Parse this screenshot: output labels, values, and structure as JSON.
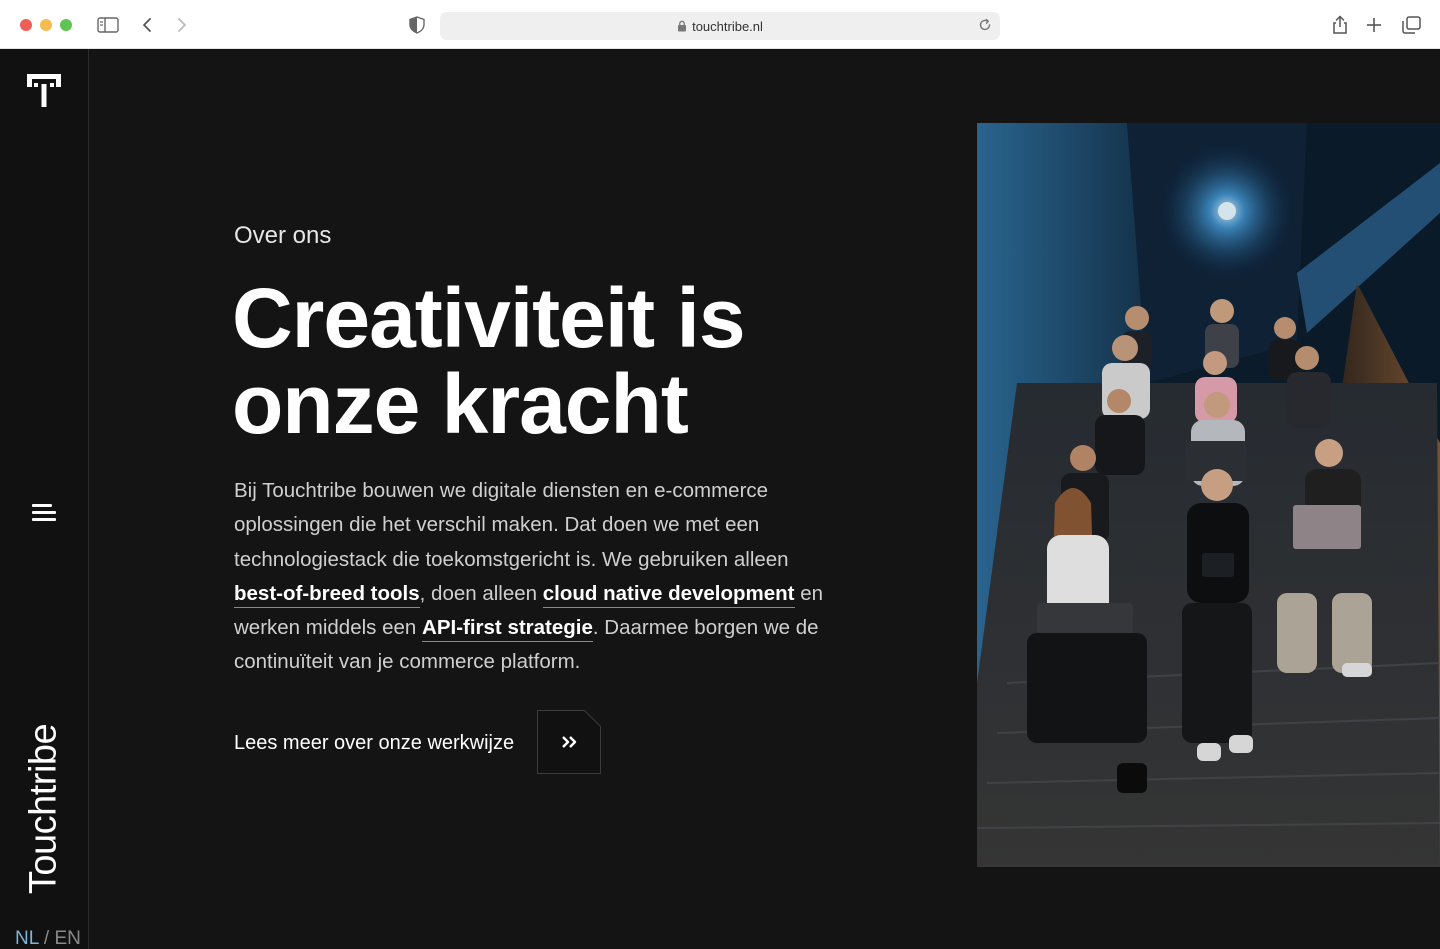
{
  "browser": {
    "url": "touchtribe.nl"
  },
  "sidebar": {
    "brand": "Touchtribe",
    "lang_nl": "NL",
    "lang_sep": " / ",
    "lang_en": "EN"
  },
  "hero": {
    "eyebrow": "Over ons",
    "headline_line1": "Creativiteit is",
    "headline_line2": "onze kracht",
    "body": {
      "part1": "Bij Touchtribe bouwen we digitale diensten en e-commerce oplossingen die het verschil maken. Dat doen we met een technologiestack die toekomstgericht is. We gebruiken alleen ",
      "link1": "best-of-breed tools",
      "part2": ", doen alleen ",
      "link2": "cloud native development",
      "part3": " en werken middels een ",
      "link3": "API-first strategie",
      "part4": ". Daarmee borgen we de continuïteit van je commerce platform."
    },
    "cta_label": "Lees meer over onze werkwijze",
    "cta_icon": "double-chevron-right-icon"
  },
  "photo": {
    "alt_semantic": "team-photo-on-stairs"
  },
  "colors": {
    "page_bg": "#141414",
    "sidebar_bg": "#111111",
    "lang_active": "#7fb3d9",
    "text_white": "#ffffff"
  }
}
